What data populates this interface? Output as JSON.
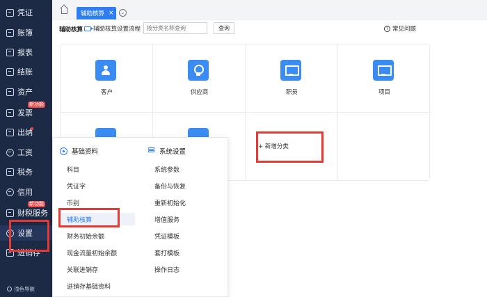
{
  "sidebar": {
    "items": [
      {
        "label": "凭证",
        "icon": "document-icon"
      },
      {
        "label": "账簿",
        "icon": "book-icon"
      },
      {
        "label": "报表",
        "icon": "report-icon"
      },
      {
        "label": "结账",
        "icon": "checkout-icon"
      },
      {
        "label": "资产",
        "icon": "asset-icon"
      },
      {
        "label": "发票",
        "icon": "invoice-icon",
        "badge": "新功能"
      },
      {
        "label": "出纳",
        "icon": "cashier-icon",
        "dot": true
      },
      {
        "label": "工资",
        "icon": "salary-icon"
      },
      {
        "label": "税务",
        "icon": "tax-icon"
      },
      {
        "label": "信用",
        "icon": "credit-icon"
      },
      {
        "label": "财税服务",
        "icon": "service-icon",
        "badge": "新功能"
      },
      {
        "label": "设置",
        "icon": "settings-icon"
      },
      {
        "label": "进销存",
        "icon": "inventory-icon"
      }
    ],
    "footer": "浅色导航"
  },
  "tabs": {
    "active_label": "辅助核算",
    "close_glyph": "×",
    "more_glyph": "⊙"
  },
  "toolbar": {
    "title": "辅助核算",
    "flow_link": "辅助核算设置流程",
    "search_placeholder": "按分类名称查询",
    "search_button": "查询",
    "faq": "常见问题"
  },
  "categories": [
    {
      "label": "客户",
      "icon": "person-icon"
    },
    {
      "label": "供应商",
      "icon": "medal-icon"
    },
    {
      "label": "职员",
      "icon": "monitor-icon"
    },
    {
      "label": "项目",
      "icon": "monitor-icon"
    }
  ],
  "add_category": "+ 新增分类",
  "dropdown": {
    "basic_title": "基础资料",
    "basic_items": [
      "科目",
      "凭证字",
      "币别",
      "辅助核算",
      "财务初始余额",
      "现金流量初始余额",
      "关联进销存",
      "进销存基础资料"
    ],
    "system_title": "系统设置",
    "system_items": [
      "系统参数",
      "备份与恢复",
      "重新初始化",
      "增值服务",
      "凭证模板",
      "套打模板",
      "操作日志"
    ]
  },
  "colors": {
    "sidebar_bg": "#1c2a45",
    "accent": "#2f7ef0",
    "highlight": "#e53935",
    "badge": "#f04b4b"
  }
}
